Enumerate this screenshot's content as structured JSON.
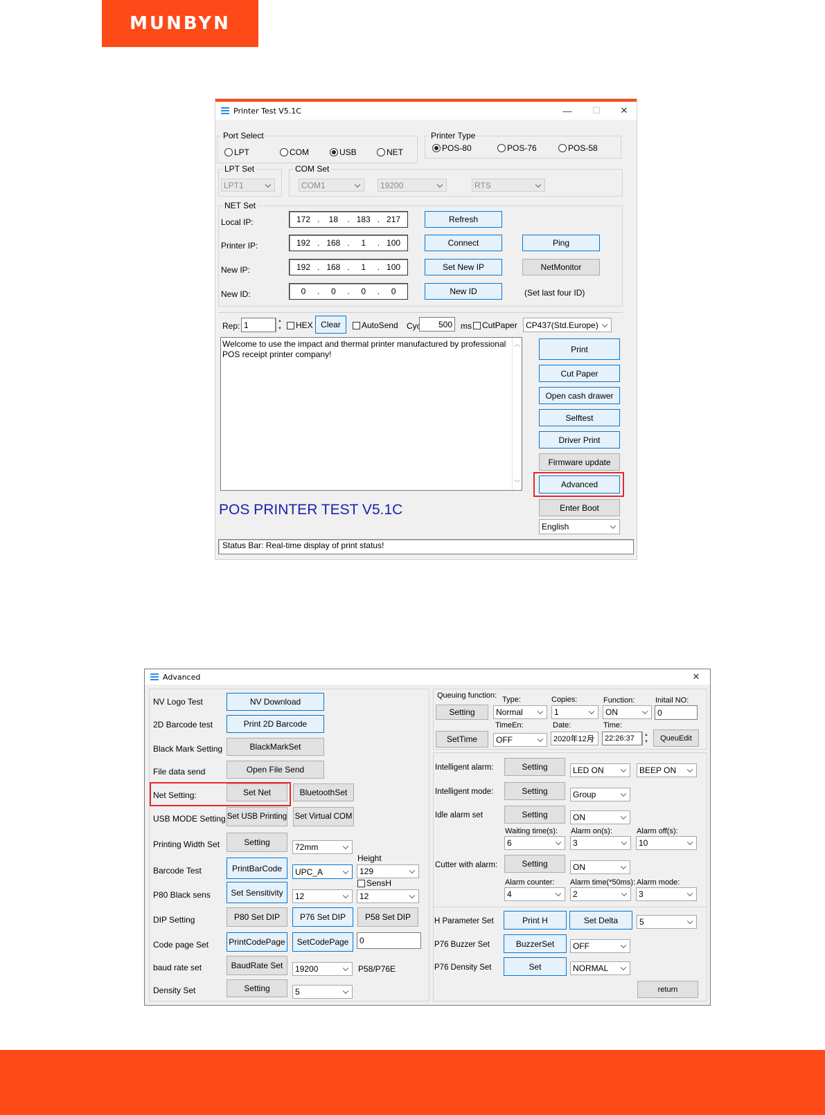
{
  "brand": {
    "logo": "MUNBYN",
    "color": "#fd4a18"
  },
  "w1": {
    "title": "Printer Test V5.1C",
    "controls": {
      "minimize": "—",
      "maximize": "☐",
      "close": "✕"
    },
    "port_select": {
      "label": "Port Select",
      "options": [
        "LPT",
        "COM",
        "USB",
        "NET"
      ],
      "selected": "USB"
    },
    "printer_type": {
      "label": "Printer Type",
      "options": [
        "POS-80",
        "POS-76",
        "POS-58"
      ],
      "selected": "POS-80"
    },
    "lpt_set": {
      "label": "LPT Set",
      "value": "LPT1"
    },
    "com_set": {
      "label": "COM Set",
      "port": "COM1",
      "baud": "19200",
      "flow": "RTS"
    },
    "net_set": {
      "label": "NET Set",
      "local_ip": {
        "label": "Local IP:",
        "octets": [
          "172",
          "18",
          "183",
          "217"
        ]
      },
      "printer_ip": {
        "label": "Printer IP:",
        "octets": [
          "192",
          "168",
          "1",
          "100"
        ]
      },
      "new_ip": {
        "label": "New IP:",
        "octets": [
          "192",
          "168",
          "1",
          "100"
        ]
      },
      "new_id": {
        "label": "New ID:",
        "octets": [
          "0",
          "0",
          "0",
          "0"
        ]
      },
      "refresh": "Refresh",
      "connect": "Connect",
      "ping": "Ping",
      "set_new_ip": "Set New IP",
      "netmonitor": "NetMonitor",
      "new_id_btn": "New ID",
      "hint": "(Set last four ID)"
    },
    "send": {
      "rep_label": "Rep:",
      "rep_value": "1",
      "hex": "HEX",
      "clear": "Clear",
      "autosend": "AutoSend",
      "cyc_label": "Cyc",
      "cyc_value": "500",
      "ms": "ms",
      "cutpaper": "CutPaper",
      "codepage": "CP437(Std.Europe)"
    },
    "textarea": "Welcome to use the impact and thermal printer manufactured by professional POS receipt printer company!",
    "buttons": {
      "print": "Print",
      "cut_paper": "Cut Paper",
      "cash_drawer": "Open cash drawer",
      "selftest": "Selftest",
      "driver_print": "Driver Print",
      "firmware": "Firmware update",
      "advanced": "Advanced",
      "enter_boot": "Enter Boot"
    },
    "language": "English",
    "banner": "POS PRINTER TEST V5.1C",
    "status": "Status Bar: Real-time display of print status!"
  },
  "w2": {
    "title": "Advanced",
    "close": "✕",
    "left": {
      "nv_logo": {
        "label": "NV Logo Test",
        "btn": "NV Download"
      },
      "barcode2d": {
        "label": "2D Barcode test",
        "btn": "Print 2D Barcode"
      },
      "blackmark": {
        "label": "Black Mark Setting",
        "btn": "BlackMarkSet"
      },
      "filesend": {
        "label": "File data send",
        "btn": "Open File Send"
      },
      "net": {
        "label": "Net Setting:",
        "btn": "Set Net",
        "btn2": "BluetoothSet"
      },
      "usbmode": {
        "label": "USB MODE Setting",
        "btn": "Set USB Printing",
        "btn2": "Set Virtual COM"
      },
      "width": {
        "label": "Printing Width Set",
        "btn": "Setting",
        "value": "72mm"
      },
      "barcode": {
        "label": "Barcode Test",
        "btn": "PrintBarCode",
        "type": "UPC_A",
        "height_label": "Height",
        "height": "129"
      },
      "p80black": {
        "label": "P80 Black sens",
        "btn": "Set Sensitivity",
        "value": "12",
        "sensh": "SensH",
        "sensh_value": "12"
      },
      "dip": {
        "label": "DIP Setting",
        "btn1": "P80 Set DIP",
        "btn2": "P76 Set DIP",
        "btn3": "P58 Set DIP"
      },
      "codepage": {
        "label": "Code page Set",
        "btn1": "PrintCodePage",
        "btn2": "SetCodePage",
        "value": "0"
      },
      "baud": {
        "label": "baud rate set",
        "btn": "BaudRate Set",
        "value": "19200",
        "note": "P58/P76E"
      },
      "density": {
        "label": "Density Set",
        "btn": "Setting",
        "value": "5"
      }
    },
    "right": {
      "queue": {
        "label": "Queuing function:",
        "setting": "Setting",
        "settime": "SetTime",
        "queuedit": "QueuEdit",
        "type_label": "Type:",
        "type": "Normal",
        "copies_label": "Copies:",
        "copies": "1",
        "function_label": "Function:",
        "function": "ON",
        "initial_label": "Initail NO:",
        "initial": "0",
        "timeen_label": "TimeEn:",
        "timeen": "OFF",
        "date_label": "Date:",
        "date": "2020年12月",
        "time_label": "Time:",
        "time": "22:26:37"
      },
      "int_alarm": {
        "label": "Intelligent alarm:",
        "btn": "Setting",
        "led": "LED ON",
        "beep": "BEEP ON"
      },
      "int_mode": {
        "label": "Intelligent mode:",
        "btn": "Setting",
        "value": "Group"
      },
      "idle": {
        "label": "Idle alarm set",
        "btn": "Setting",
        "value": "ON",
        "wait_label": "Waiting time(s):",
        "wait": "6",
        "on_label": "Alarm on(s):",
        "on": "3",
        "off_label": "Alarm off(s):",
        "off": "10"
      },
      "cutter": {
        "label": "Cutter with alarm:",
        "btn": "Setting",
        "value": "ON",
        "counter_label": "Alarm counter:",
        "counter": "4",
        "time_label": "Alarm time(*50ms):",
        "time": "2",
        "mode_label": "Alarm mode:",
        "mode": "3"
      },
      "hparam": {
        "label": "H Parameter Set",
        "btn1": "Print H",
        "btn2": "Set Delta",
        "value": "5"
      },
      "buzzer": {
        "label": "P76 Buzzer Set",
        "btn": "BuzzerSet",
        "value": "OFF"
      },
      "p76density": {
        "label": "P76 Density Set",
        "btn": "Set",
        "value": "NORMAL"
      },
      "return": "return"
    }
  }
}
